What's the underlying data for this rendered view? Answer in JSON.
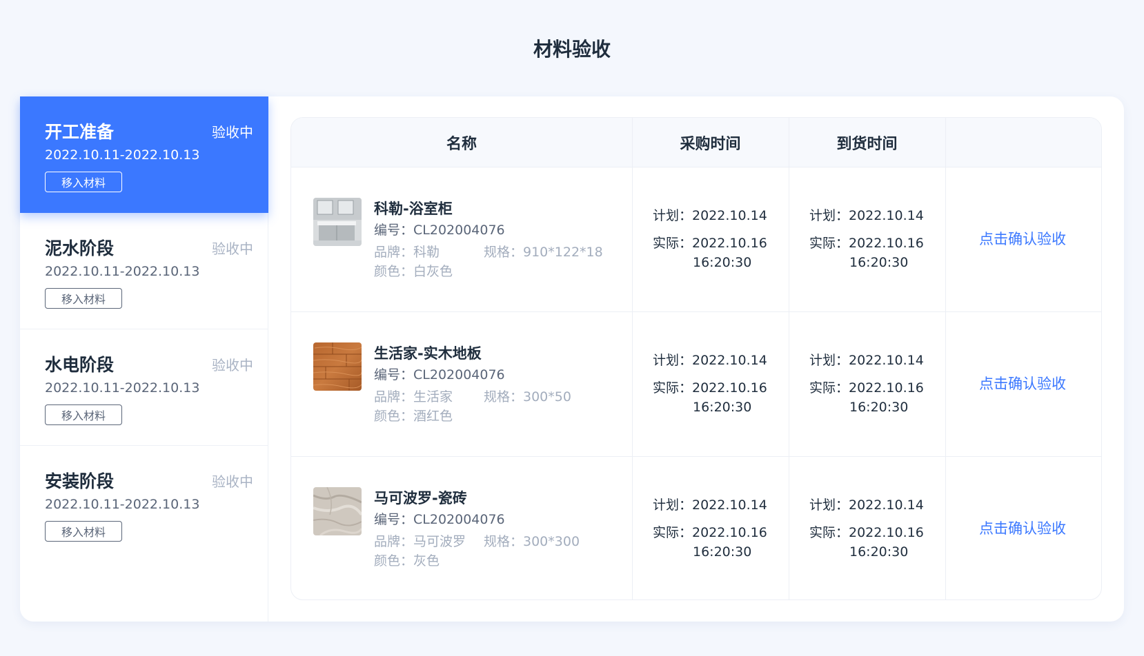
{
  "page": {
    "title": "材料验收"
  },
  "stages": [
    {
      "name": "开工准备",
      "status": "验收中",
      "date": "2022.10.11-2022.10.13",
      "button": "移入材料",
      "active": true
    },
    {
      "name": "泥水阶段",
      "status": "验收中",
      "date": "2022.10.11-2022.10.13",
      "button": "移入材料",
      "active": false
    },
    {
      "name": "水电阶段",
      "status": "验收中",
      "date": "2022.10.11-2022.10.13",
      "button": "移入材料",
      "active": false
    },
    {
      "name": "安装阶段",
      "status": "验收中",
      "date": "2022.10.11-2022.10.13",
      "button": "移入材料",
      "active": false
    }
  ],
  "table": {
    "headers": [
      "名称",
      "采购时间",
      "到货时间",
      ""
    ],
    "rows": [
      {
        "name": "科勒-浴室柜",
        "code": "编号：CL202004076",
        "brand": "品牌：科勒",
        "spec": "规格：910*122*18",
        "color": "颜色：白灰色",
        "thumb": "bathroom-cabinet",
        "purchase": {
          "plan": "计划：2022.10.14",
          "actual": "实际：2022.10.16",
          "actual_time": "16:20:30"
        },
        "arrival": {
          "plan": "计划：2022.10.14",
          "actual": "实际：2022.10.16",
          "actual_time": "16:20:30"
        },
        "action": "点击确认验收"
      },
      {
        "name": "生活家-实木地板",
        "code": "编号：CL202004076",
        "brand": "品牌：生活家",
        "spec": "规格：300*50",
        "color": "颜色：酒红色",
        "thumb": "wood-floor",
        "purchase": {
          "plan": "计划：2022.10.14",
          "actual": "实际：2022.10.16",
          "actual_time": "16:20:30"
        },
        "arrival": {
          "plan": "计划：2022.10.14",
          "actual": "实际：2022.10.16",
          "actual_time": "16:20:30"
        },
        "action": "点击确认验收"
      },
      {
        "name": "马可波罗-瓷砖",
        "code": "编号：CL202004076",
        "brand": "品牌：马可波罗",
        "spec": "规格：300*300",
        "color": "颜色：灰色",
        "thumb": "marble-tile",
        "purchase": {
          "plan": "计划：2022.10.14",
          "actual": "实际：2022.10.16",
          "actual_time": "16:20:30"
        },
        "arrival": {
          "plan": "计划：2022.10.14",
          "actual": "实际：2022.10.16",
          "actual_time": "16:20:30"
        },
        "action": "点击确认验收"
      }
    ]
  },
  "colors": {
    "accent": "#3b78ff",
    "background": "#f4f7fd",
    "text": "#1f2d3d",
    "muted": "#a3adbd"
  }
}
